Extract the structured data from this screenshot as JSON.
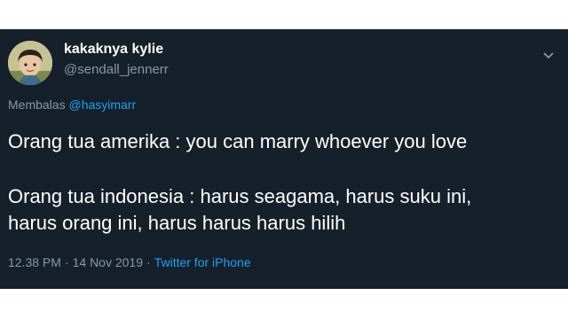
{
  "tweet": {
    "display_name": "kakaknya kylie",
    "handle": "@sendall_jennerr",
    "reply_prefix": "Membalas",
    "reply_to": "@hasyimarr",
    "text_lines": [
      "Orang tua amerika : you can marry whoever you love",
      "Orang tua indonesia : harus seagama, harus suku ini,",
      "harus orang ini, harus harus harus hilih"
    ],
    "time": "12.38 PM",
    "separator": "·",
    "date": "14 Nov 2019",
    "meta_separator": "·",
    "source": "Twitter for iPhone"
  },
  "icons": {
    "avatar": "avatar",
    "menu": "chevron-down-icon"
  },
  "colors": {
    "background": "#15202b",
    "text": "#ffffff",
    "secondary": "#8899a6",
    "accent": "#1da1f2"
  }
}
